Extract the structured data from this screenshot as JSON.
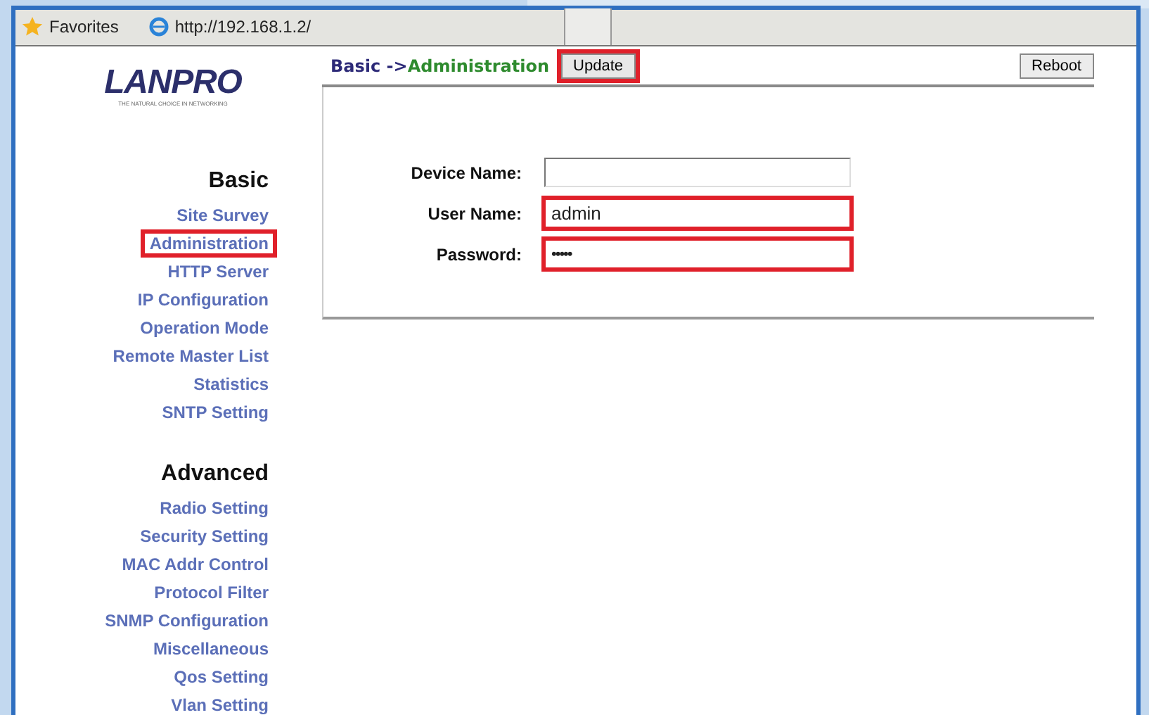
{
  "browser": {
    "favorites": "Favorites",
    "tab_title": "http://192.168.1.2/"
  },
  "header": {
    "breadcrumb_parent": "Basic ->",
    "breadcrumb_current": "Administration",
    "update_button": {
      "label": "Update",
      "highlighted": true
    },
    "reboot_button": {
      "label": "Reboot",
      "highlighted": false
    }
  },
  "logo": {
    "name": "LANPRO",
    "tagline": "THE NATURAL CHOICE IN NETWORKING"
  },
  "sidebar": [
    {
      "heading": "Basic",
      "items": [
        {
          "label": "Site Survey",
          "highlighted": false
        },
        {
          "label": "Administration",
          "highlighted": true
        },
        {
          "label": "HTTP Server",
          "highlighted": false
        },
        {
          "label": "IP Configuration",
          "highlighted": false
        },
        {
          "label": "Operation Mode",
          "highlighted": false
        },
        {
          "label": "Remote Master List",
          "highlighted": false
        },
        {
          "label": "Statistics",
          "highlighted": false
        },
        {
          "label": "SNTP Setting",
          "highlighted": false
        }
      ]
    },
    {
      "heading": "Advanced",
      "items": [
        {
          "label": "Radio Setting",
          "highlighted": false
        },
        {
          "label": "Security Setting",
          "highlighted": false
        },
        {
          "label": "MAC Addr Control",
          "highlighted": false
        },
        {
          "label": "Protocol Filter",
          "highlighted": false
        },
        {
          "label": "SNMP Configuration",
          "highlighted": false
        },
        {
          "label": "Miscellaneous",
          "highlighted": false
        },
        {
          "label": "Qos Setting",
          "highlighted": false
        },
        {
          "label": "Vlan Setting",
          "highlighted": false
        }
      ]
    }
  ],
  "form": {
    "fields": [
      {
        "label": "Device Name:",
        "kind": "text",
        "highlighted": false
      },
      {
        "label": "User Name:",
        "value": "admin",
        "kind": "text",
        "highlighted": true
      },
      {
        "label": "Password:",
        "value": "•••••",
        "kind": "password",
        "highlighted": true
      }
    ]
  }
}
